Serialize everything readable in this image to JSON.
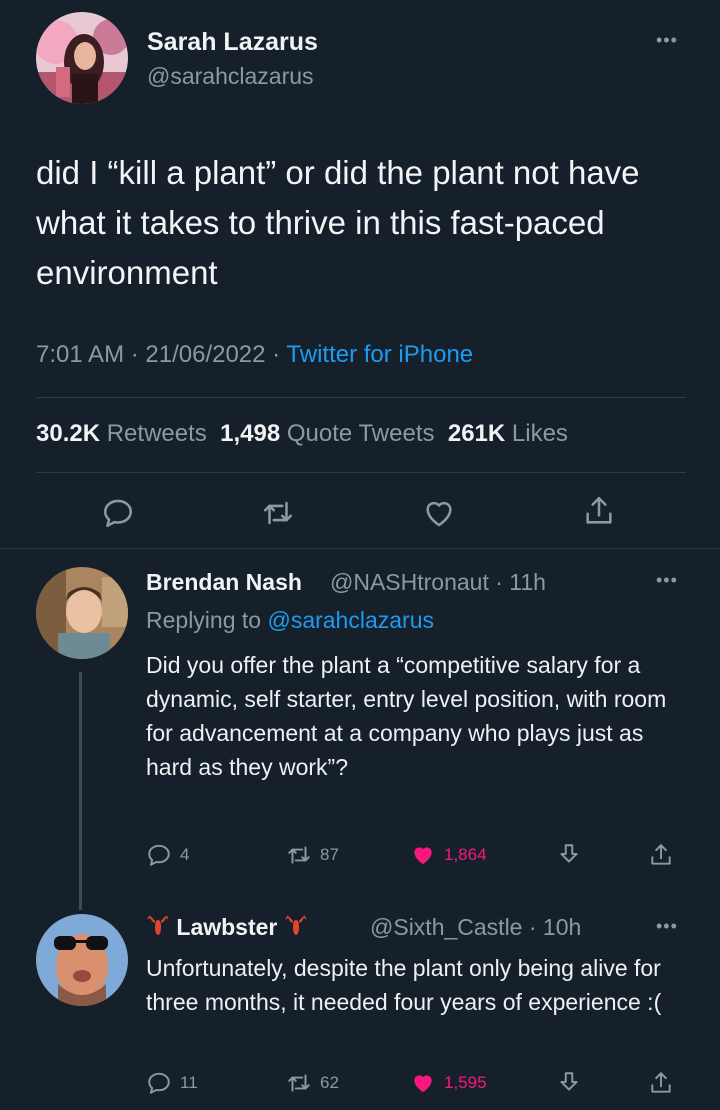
{
  "main": {
    "name": "Sarah Lazarus",
    "handle": "@sarahclazarus",
    "text": "did I “kill a plant” or did the plant not have what it takes to thrive in this fast-paced environment",
    "time": "7:01 AM · 21/06/2022 · ",
    "source": "Twitter for iPhone",
    "retweets": "30.2K",
    "retweets_label": "Retweets",
    "quotes": "1,498",
    "quotes_label": "Quote Tweets",
    "likes": "261K",
    "likes_label": "Likes",
    "more": "•••"
  },
  "replies": [
    {
      "name": "Brendan Nash",
      "handle": "@NASHtronaut · 11h",
      "replying_prefix": "Replying to ",
      "replying_to": "@sarahclazarus",
      "text": "Did you offer the plant a “competitive salary for a dynamic, self starter, entry level position, with room for advancement at a company who plays just as hard as they work”?",
      "replies_count": "4",
      "retweets_count": "87",
      "likes_count": "1,864",
      "more": "•••"
    },
    {
      "name": "Lawbster",
      "handle": "@Sixth_Castle · 10h",
      "text": "Unfortunately, despite the plant only being alive for three months, it needed four years of experience :(",
      "replies_count": "11",
      "retweets_count": "62",
      "likes_count": "1,595",
      "more": "•••"
    }
  ],
  "icons": {
    "reply": "reply-icon",
    "retweet": "retweet-icon",
    "like": "heart-icon",
    "share": "share-icon",
    "download": "download-icon",
    "lobster": "lobster-emoji-icon"
  },
  "colors": {
    "background": "#15202b",
    "link": "#1d9bf0",
    "like": "#f91880",
    "muted": "#8b98a5"
  }
}
